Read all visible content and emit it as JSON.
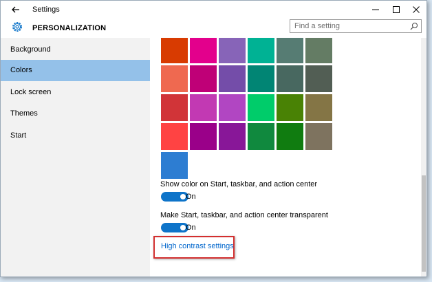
{
  "window": {
    "title": "Settings",
    "controls": [
      "minimize",
      "maximize",
      "close"
    ]
  },
  "header": {
    "title": "PERSONALIZATION",
    "search_placeholder": "Find a setting"
  },
  "sidebar": {
    "items": [
      {
        "label": "Background",
        "active": false
      },
      {
        "label": "Colors",
        "active": true
      },
      {
        "label": "Lock screen",
        "active": false
      },
      {
        "label": "Themes",
        "active": false
      },
      {
        "label": "Start",
        "active": false
      }
    ]
  },
  "colors": {
    "swatches": [
      [
        "#d83b01",
        "#e3008c",
        "#8764b8",
        "#00b294",
        "#567c73",
        "#647c64"
      ],
      [
        "#ef6950",
        "#bf0077",
        "#744da9",
        "#018574",
        "#486860",
        "#525e54"
      ],
      [
        "#d13438",
        "#c239b3",
        "#b146c2",
        "#00cc6a",
        "#498205",
        "#847545"
      ],
      [
        "#ff4343",
        "#9a0089",
        "#881798",
        "#10893e",
        "#107c10",
        "#7e735f"
      ],
      [
        "#2d7dd2"
      ]
    ],
    "accent": "#0e74c9",
    "link": "#0066cc",
    "highlight_box": "#d32f2f"
  },
  "settings": {
    "show_color_label": "Show color on Start, taskbar, and action center",
    "show_color_state": "On",
    "transparent_label": "Make Start, taskbar, and action center transparent",
    "transparent_state": "On",
    "high_contrast_link": "High contrast settings"
  }
}
